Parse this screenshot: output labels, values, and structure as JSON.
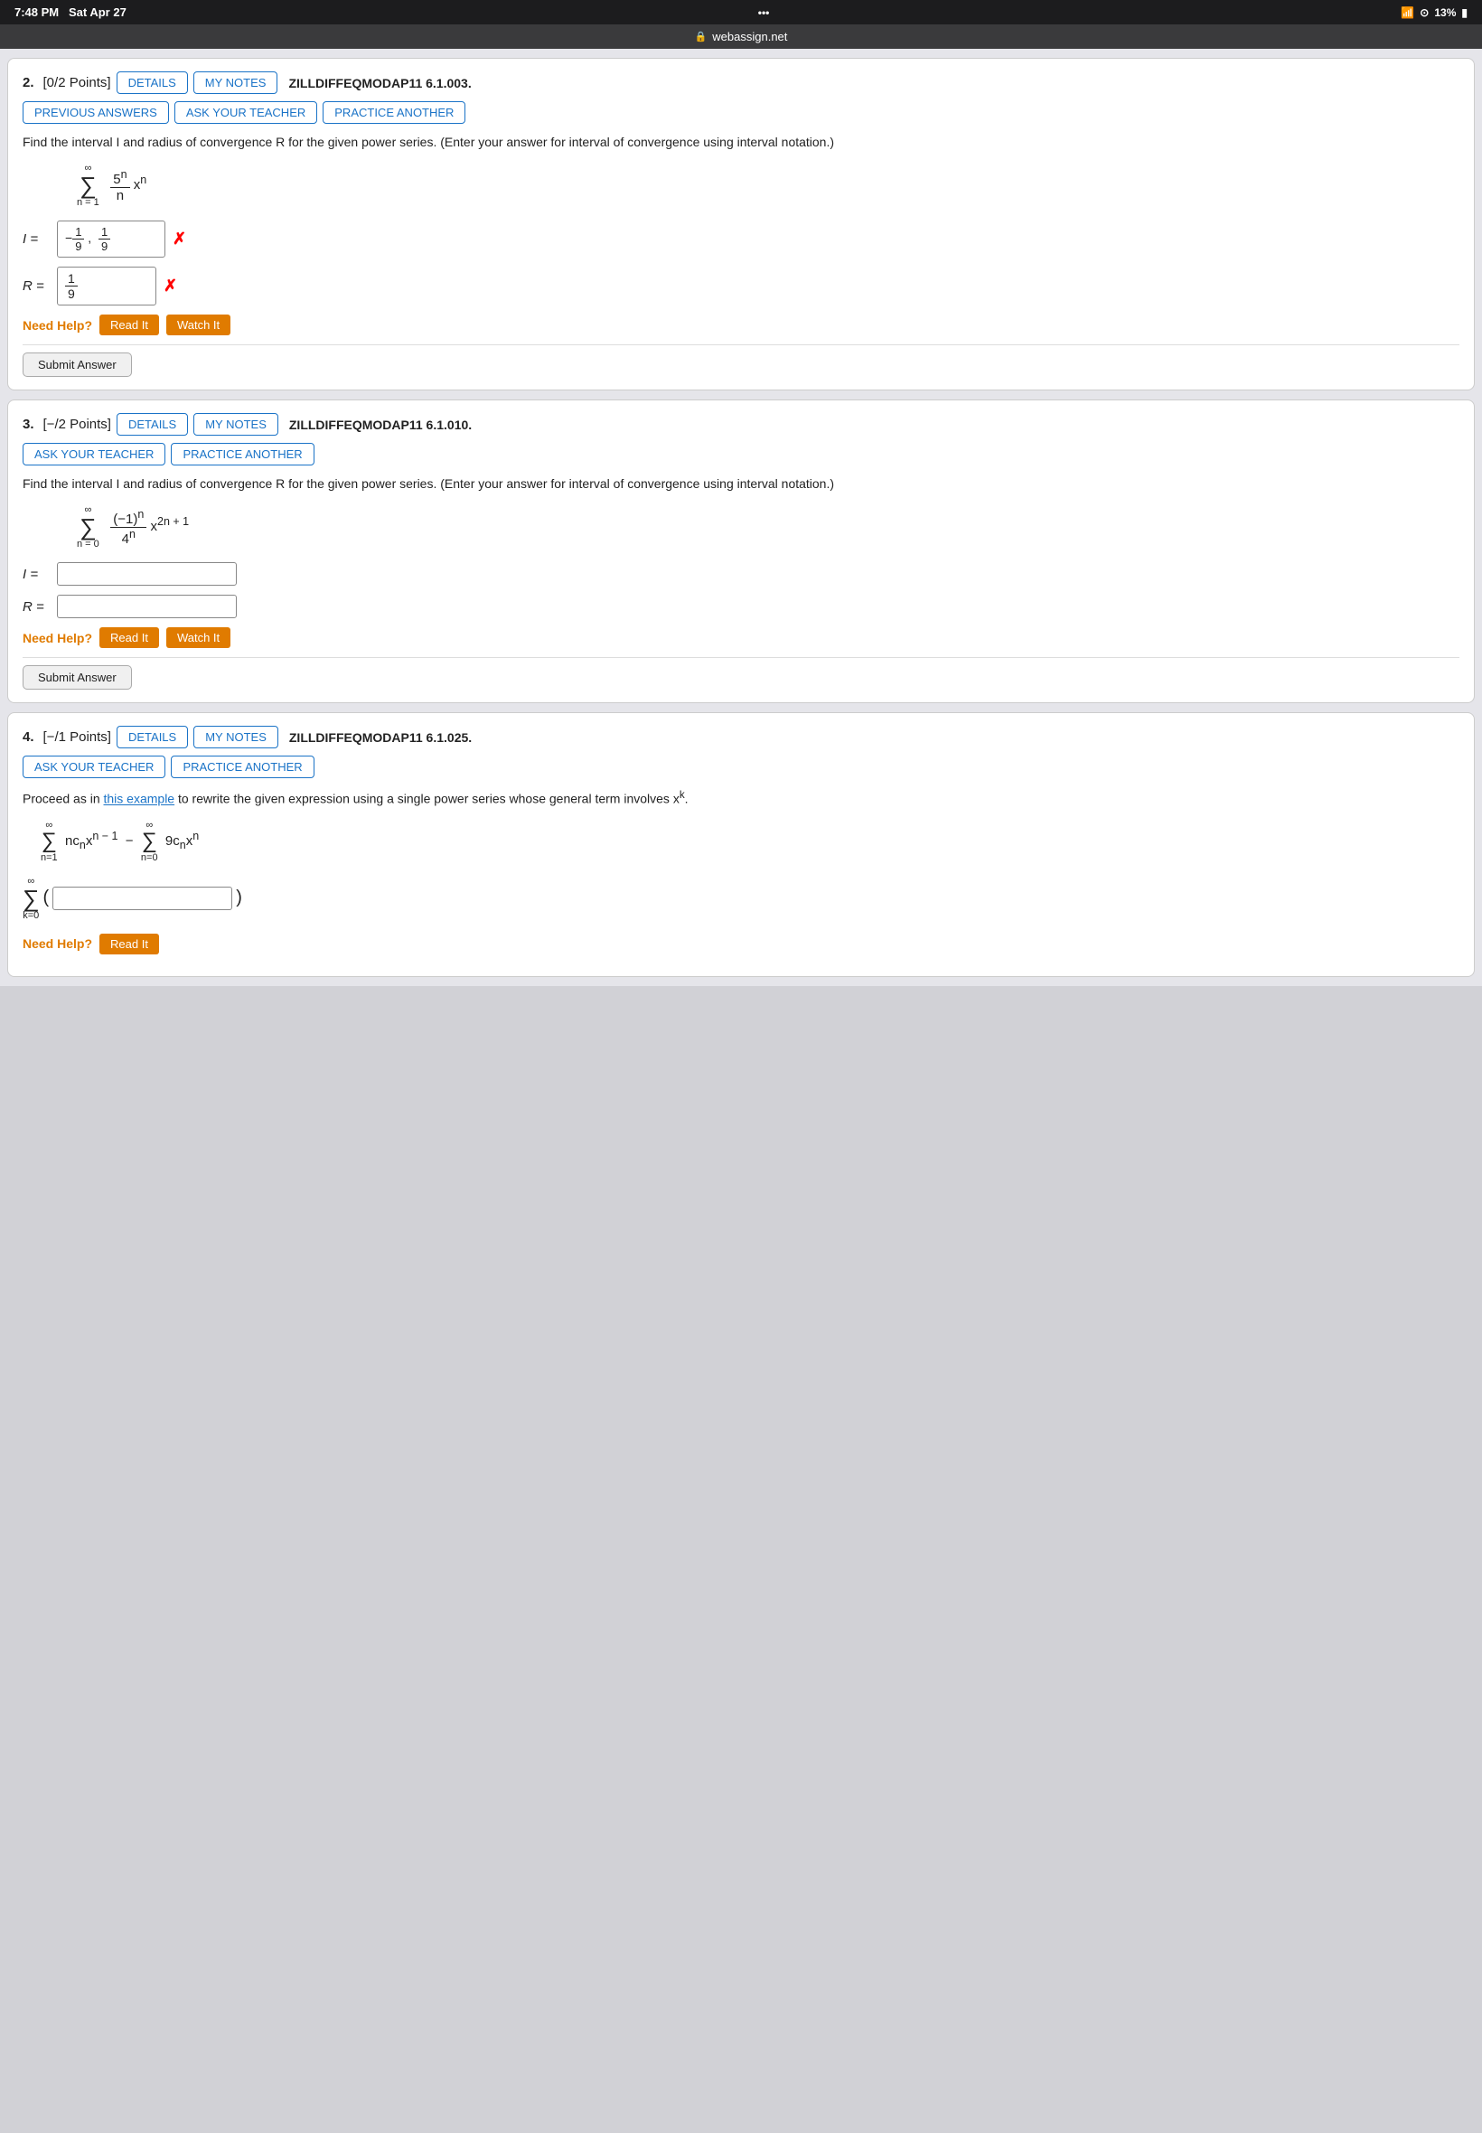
{
  "statusBar": {
    "time": "7:48 PM",
    "date": "Sat Apr 27",
    "dots": "•••",
    "wifi": "WiFi",
    "signal": "13%",
    "lock": "🔒",
    "battery": "▮"
  },
  "browserBar": {
    "lock": "🔒",
    "url": "webassign.net"
  },
  "problems": [
    {
      "id": "prob2",
      "number": "2.",
      "points": "[0/2 Points]",
      "detailsLabel": "DETAILS",
      "myNotesLabel": "MY NOTES",
      "problemId": "ZILLDIFFEQMODAP11 6.1.003.",
      "prevAnswersLabel": "PREVIOUS ANSWERS",
      "askTeacherLabel": "ASK YOUR TEACHER",
      "practiceLabel": "PRACTICE ANOTHER",
      "questionText": "Find the interval I and radius of convergence R for the given power series. (Enter your answer for interval of convergence using interval notation.)",
      "seriesDisplay": "∑ (5ⁿ/n) xⁿ, n=1 to ∞",
      "iLabel": "I =",
      "iValue": "−1/9, 1/9",
      "iWrong": true,
      "rLabel": "R =",
      "rValue": "1/9",
      "rWrong": true,
      "needHelpText": "Need Help?",
      "readItLabel": "Read It",
      "watchItLabel": "Watch It",
      "submitLabel": "Submit Answer"
    },
    {
      "id": "prob3",
      "number": "3.",
      "points": "[−/2 Points]",
      "detailsLabel": "DETAILS",
      "myNotesLabel": "MY NOTES",
      "problemId": "ZILLDIFFEQMODAP11 6.1.010.",
      "askTeacherLabel": "ASK YOUR TEACHER",
      "practiceLabel": "PRACTICE ANOTHER",
      "questionText": "Find the interval I and radius of convergence R for the given power series. (Enter your answer for interval of convergence using interval notation.)",
      "seriesDisplay": "∑ ((-1)ⁿ/4ⁿ) x^(2n+1), n=0 to ∞",
      "iLabel": "I =",
      "iValue": "",
      "rLabel": "R =",
      "rValue": "",
      "needHelpText": "Need Help?",
      "readItLabel": "Read It",
      "watchItLabel": "Watch It",
      "submitLabel": "Submit Answer"
    },
    {
      "id": "prob4",
      "number": "4.",
      "points": "[−/1 Points]",
      "detailsLabel": "DETAILS",
      "myNotesLabel": "MY NOTES",
      "problemId": "ZILLDIFFEQMODAP11 6.1.025.",
      "askTeacherLabel": "ASK YOUR TEACHER",
      "practiceLabel": "PRACTICE ANOTHER",
      "questionText": "Proceed as in",
      "linkText": "this example",
      "questionText2": "to rewrite the given expression using a single power series whose general term involves x",
      "questionText2sup": "k",
      "questionText2end": ".",
      "seriesDisplay": "∑ nc_n x^(n-1) − ∑ 9c_n x^n, n=1 and n=0",
      "sumLabel": "∑",
      "sumSub": "k=0",
      "iValue": "",
      "needHelpText": "Need Help?",
      "readItLabel": "Read It"
    }
  ]
}
